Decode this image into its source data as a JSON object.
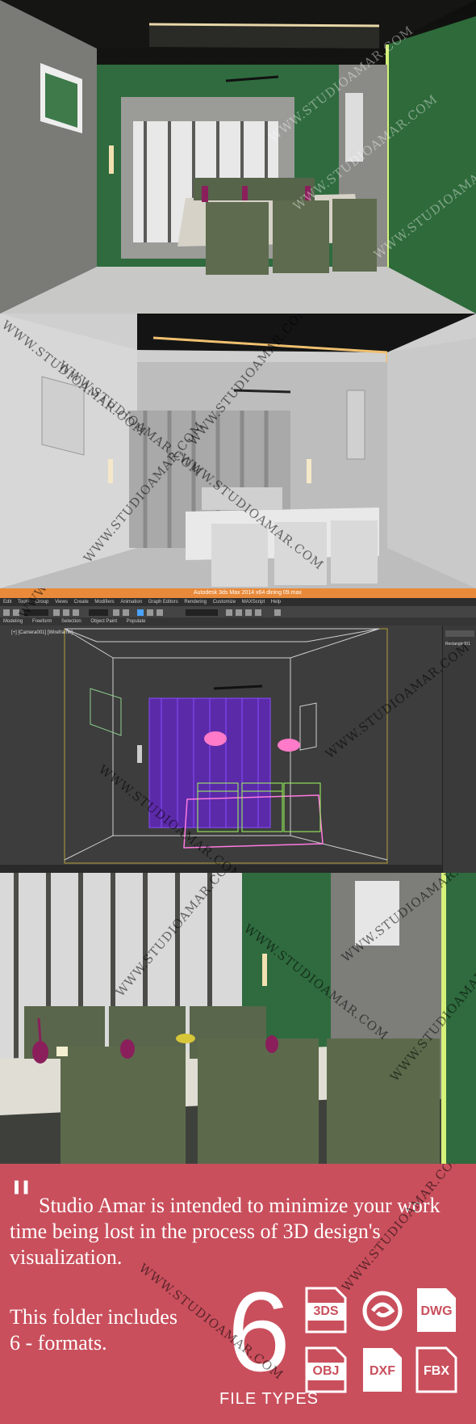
{
  "viewport": {
    "window_title": "Autodesk 3ds Max  2014 x64     dining 09.max",
    "menu_items": [
      "Edit",
      "Tools",
      "Group",
      "Views",
      "Create",
      "Modifiers",
      "Animation",
      "Graph Editors",
      "Rendering",
      "Customize",
      "MAXScript",
      "Help"
    ],
    "ribbon_tabs": [
      "Modeling",
      "Freeform",
      "Selection",
      "Object Paint",
      "Populate"
    ],
    "viewport_label": "[+] [Camera001] [Wireframe]",
    "object_name": "Rectangle001"
  },
  "promo": {
    "quote_mark": "\"",
    "headline": "Studio Amar is intended to minimize your work time being lost in the process of 3D design's visualization.",
    "folder_line_1": "This folder includes",
    "folder_line_2": "6 - formats.",
    "count": "6",
    "count_caption": "FILE TYPES",
    "formats": [
      {
        "label": "3DS",
        "icon": "3ds-file-icon"
      },
      {
        "label": "",
        "icon": "autodesk-max-logo-icon"
      },
      {
        "label": "DWG",
        "icon": "dwg-file-icon"
      },
      {
        "label": "OBJ",
        "icon": "obj-file-icon"
      },
      {
        "label": "DXF",
        "icon": "dxf-file-icon"
      },
      {
        "label": "FBX",
        "icon": "fbx-file-icon"
      }
    ]
  },
  "watermark": "WWW.STUDIOAMAR.COM",
  "colors": {
    "promo_bg": "#c94f5c",
    "wall_green": "#2f6b3e",
    "max_title": "#e88a3a",
    "wire_purple": "#7a3cff",
    "wire_green": "#9dff5a"
  }
}
